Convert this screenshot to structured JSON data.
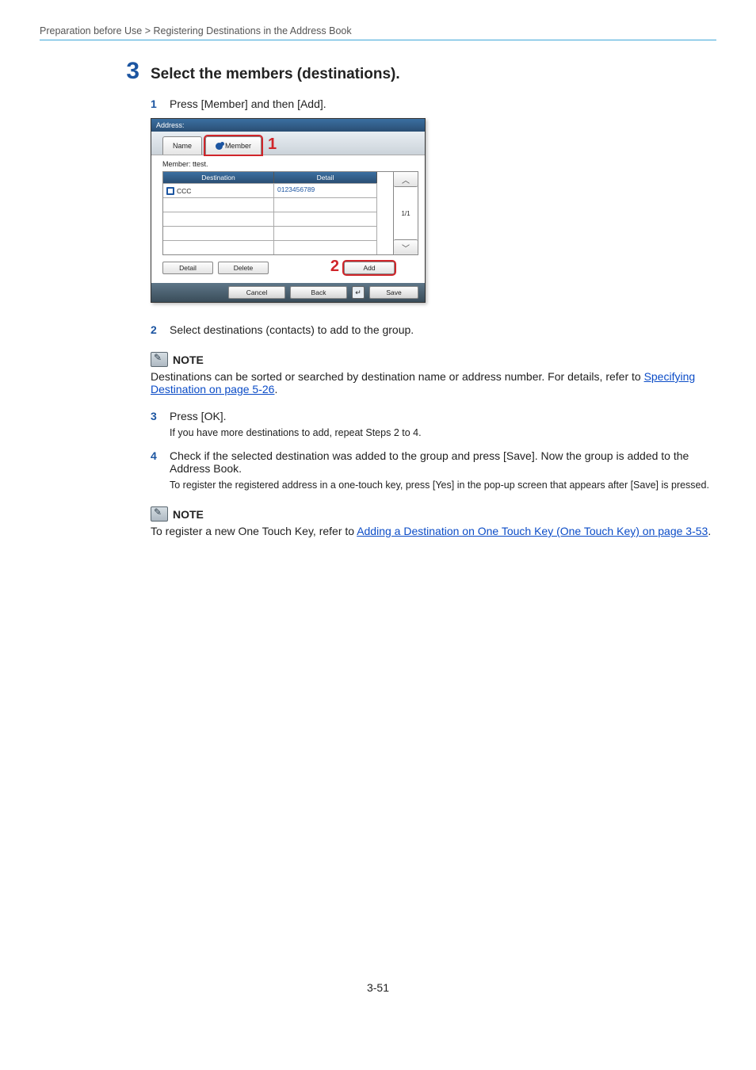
{
  "breadcrumb": "Preparation before Use > Registering Destinations in the Address Book",
  "step": {
    "number": "3",
    "title": "Select the members (destinations)."
  },
  "sub1": {
    "num": "1",
    "text": "Press [Member] and then [Add]."
  },
  "device": {
    "titlebar": "Address:",
    "tab_name": "Name",
    "tab_member": "Member",
    "callout1": "1",
    "member_label": "Member: ttest.",
    "col_destination": "Destination",
    "col_detail": "Detail",
    "row_dest": "CCC",
    "row_detail": "0123456789",
    "page_indicator": "1/1",
    "btn_detail": "Detail",
    "btn_delete": "Delete",
    "callout2": "2",
    "btn_add": "Add",
    "btn_cancel": "Cancel",
    "btn_back": "Back",
    "enter_glyph": "↵",
    "btn_save": "Save"
  },
  "sub2": {
    "num": "2",
    "text": "Select destinations (contacts) to add to the group."
  },
  "note1": {
    "label": "NOTE",
    "text_pre": "Destinations can be sorted or searched by destination name or address number. For details, refer to ",
    "link": "Specifying Destination on page 5-26",
    "text_post": "."
  },
  "sub3": {
    "num": "3",
    "text": "Press [OK].",
    "detail": "If you have more destinations to add, repeat Steps 2 to 4."
  },
  "sub4": {
    "num": "4",
    "text": "Check if the selected destination was added to the group and press [Save]. Now the group is added to the Address Book.",
    "detail": "To register the registered address in a one-touch key, press [Yes] in the pop-up screen that appears after [Save] is pressed."
  },
  "note2": {
    "label": "NOTE",
    "text_pre": "To register a new One Touch Key, refer to ",
    "link": "Adding a Destination on One Touch Key (One Touch Key) on page 3-53",
    "text_post": "."
  },
  "page_number": "3-51"
}
